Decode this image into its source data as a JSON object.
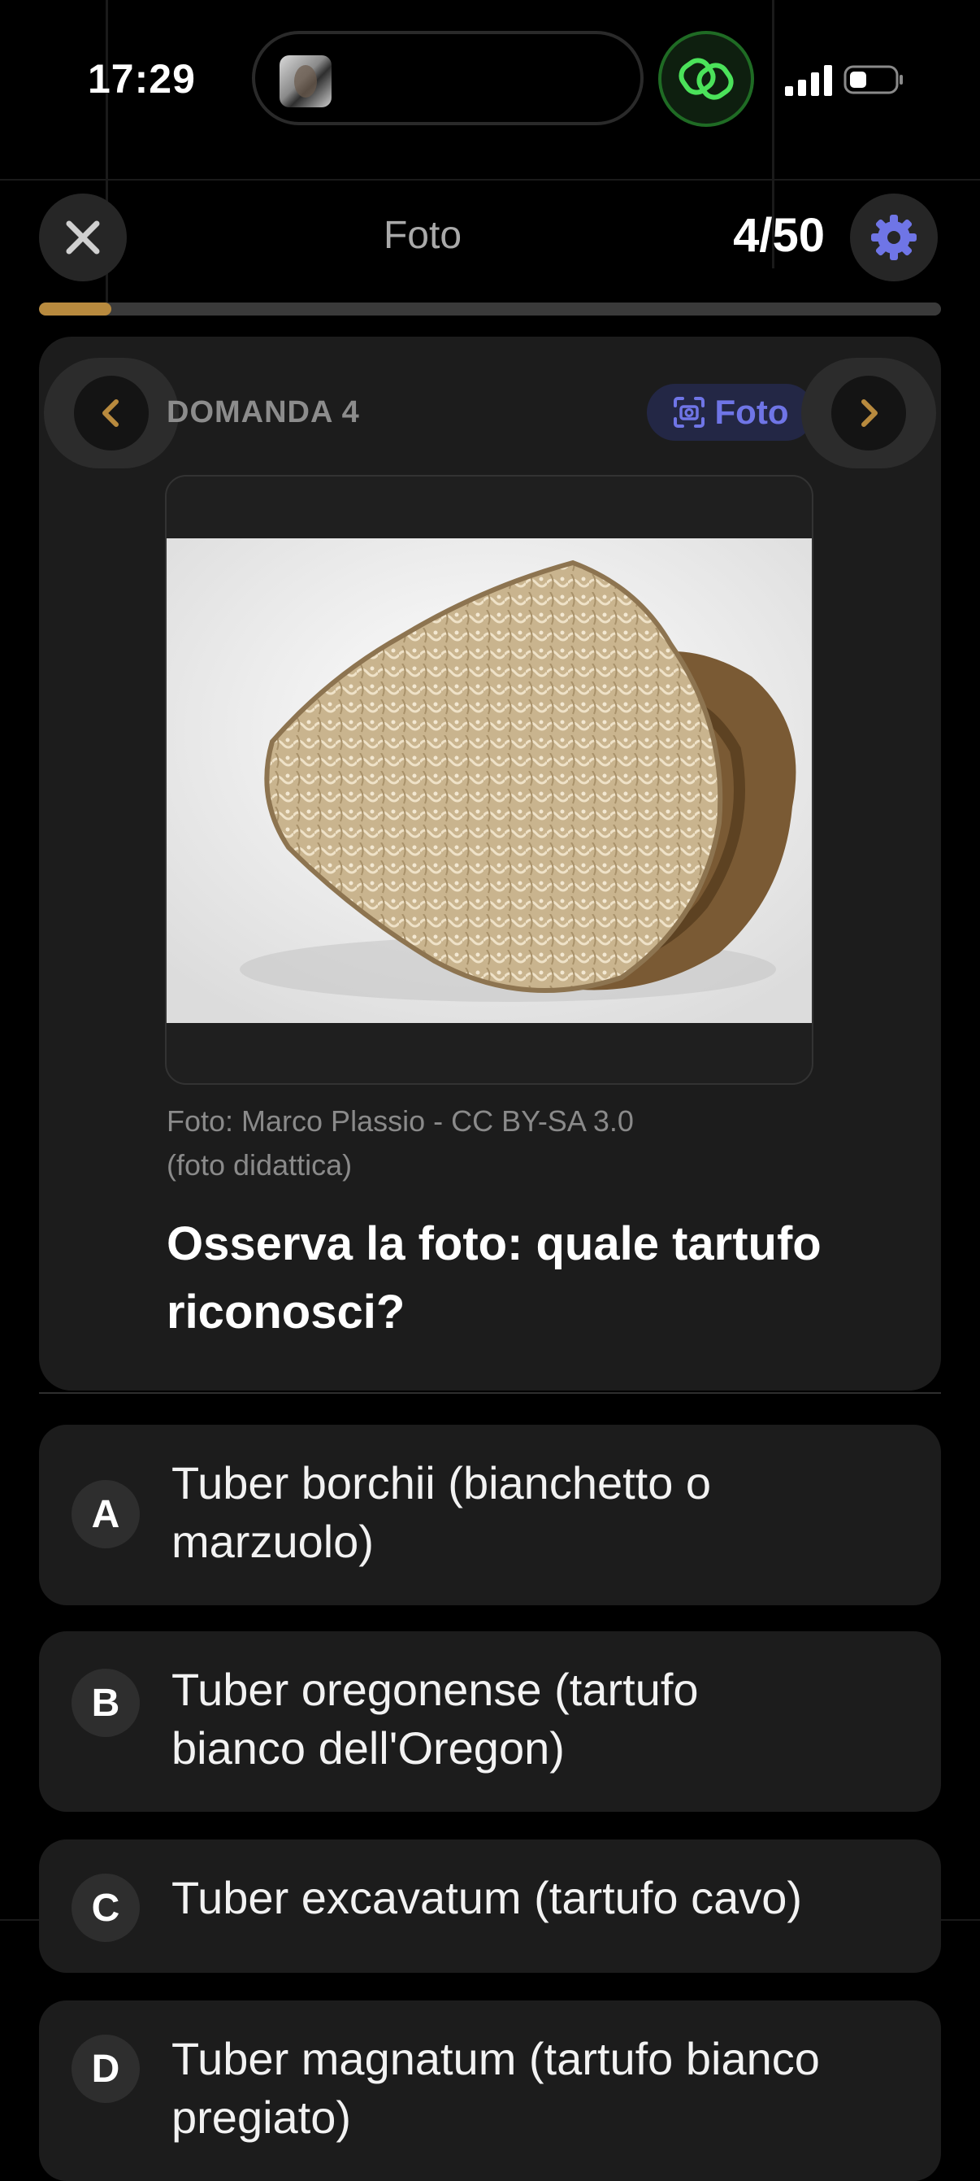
{
  "status_bar": {
    "time": "17:29"
  },
  "header": {
    "title": "Foto",
    "counter": "4/50",
    "progress": 0.08,
    "accent_color": "#b88a3e",
    "gear_color": "#6f75e6"
  },
  "question_card": {
    "label": "DOMANDA 4",
    "badge_label": "Foto",
    "credit_line1": "Foto: Marco Plassio - CC BY-SA 3.0",
    "credit_line2": "(foto didattica)",
    "question": "Osserva la foto: quale tartufo riconosci?"
  },
  "answers": [
    {
      "letter": "A",
      "text": "Tuber borchii (bianchetto o marzuolo)"
    },
    {
      "letter": "B",
      "text": "Tuber oregonense (tartufo bianco dell'Oregon)"
    },
    {
      "letter": "C",
      "text": "Tuber excavatum (tartufo cavo)"
    },
    {
      "letter": "D",
      "text": "Tuber magnatum (tartufo bianco pregiato)"
    }
  ]
}
